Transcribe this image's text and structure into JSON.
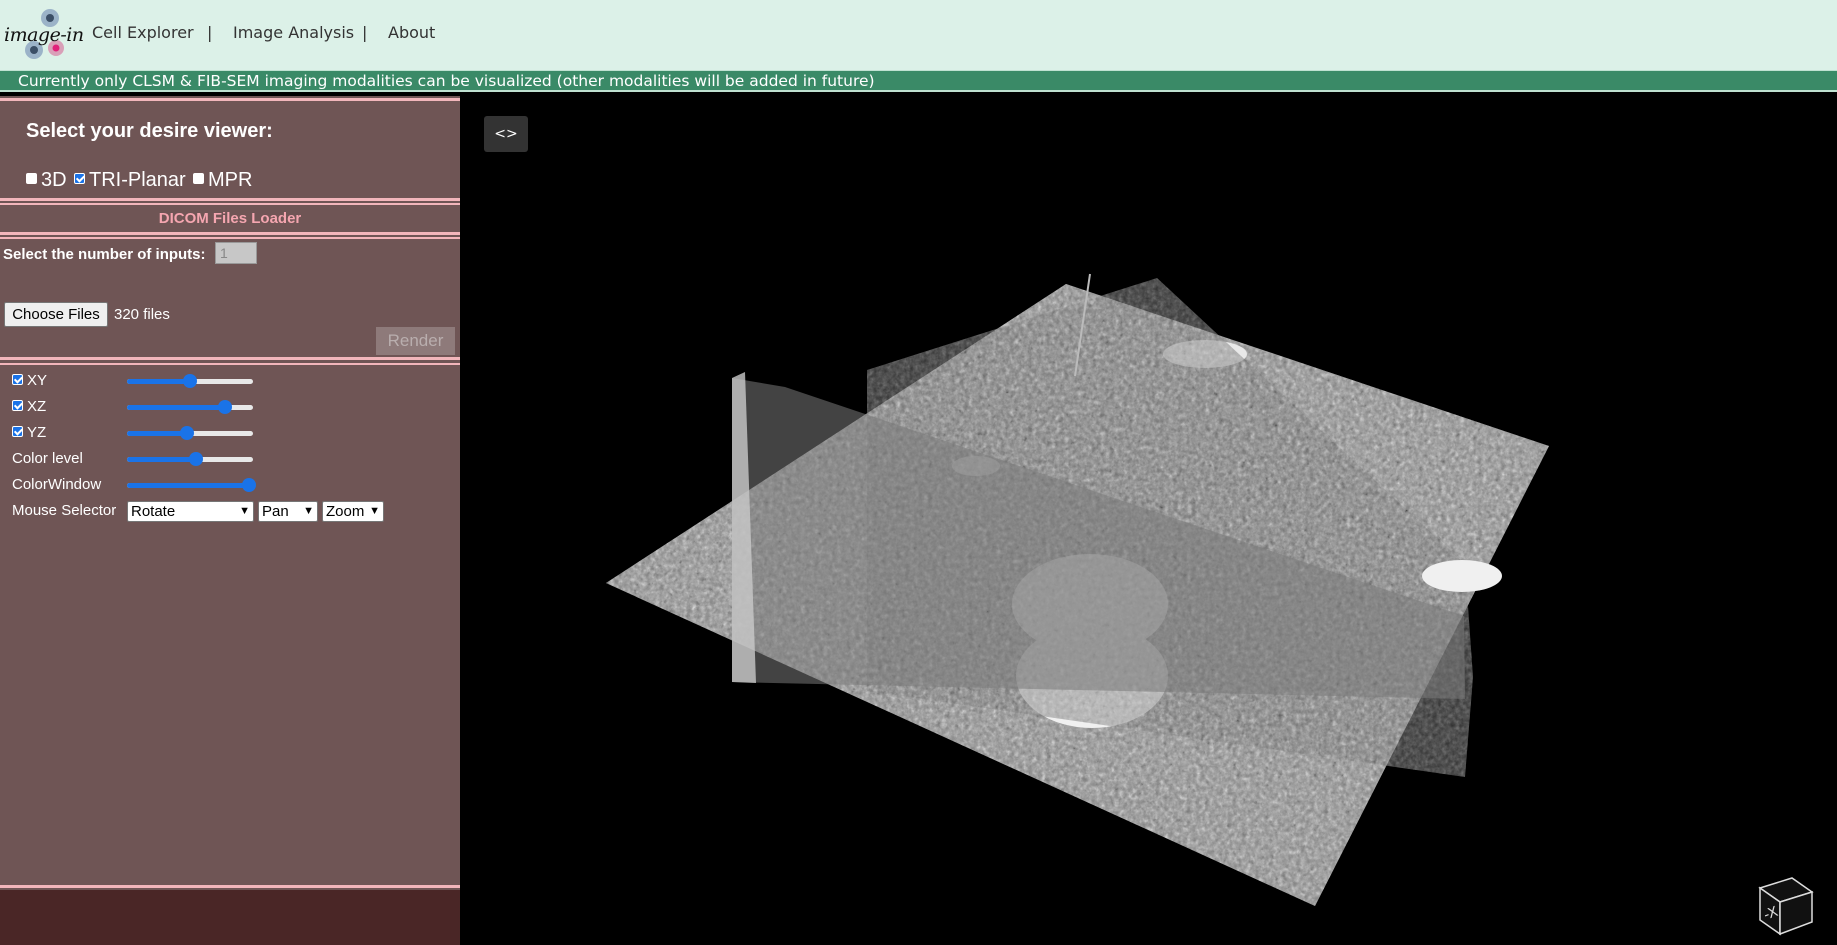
{
  "nav": {
    "logo_text": "image-in",
    "links": [
      "Cell Explorer",
      "Image Analysis",
      "About"
    ],
    "separator": "|"
  },
  "banner": {
    "text": "Currently only CLSM & FIB-SEM imaging modalities can be visualized (other modalities will be added in future)"
  },
  "panel": {
    "viewer_title": "Select your desire viewer:",
    "viewer_options": [
      {
        "label": "3D",
        "checked": false
      },
      {
        "label": "TRI-Planar",
        "checked": true
      },
      {
        "label": "MPR",
        "checked": false
      }
    ],
    "loader_title": "DICOM Files Loader",
    "inputs_label": "Select the number of inputs:",
    "inputs_value": "1",
    "choose_files_label": "Choose Files",
    "files_count": "320 files",
    "render_label": "Render",
    "planes": [
      {
        "label": "XY",
        "checked": true,
        "slider": 0.5
      },
      {
        "label": "XZ",
        "checked": true,
        "slider": 0.78
      },
      {
        "label": "YZ",
        "checked": true,
        "slider": 0.48
      }
    ],
    "color_level": {
      "label": "Color level",
      "slider": 0.55
    },
    "color_window": {
      "label": "ColorWindow",
      "slider": 0.97
    },
    "mouse_selector": {
      "label": "Mouse Selector",
      "rotate": "Rotate",
      "pan": "Pan",
      "zoom": "Zoom"
    }
  },
  "viewer": {
    "toggle_label": "<>",
    "orientation_cube_label": "-X"
  },
  "colors": {
    "nav_bg": "#dcf1e8",
    "banner_bg": "#3a8a67",
    "panel_bg": "#6f5555",
    "accent": "#1a73e8",
    "loader_title": "#f5a6b0"
  }
}
